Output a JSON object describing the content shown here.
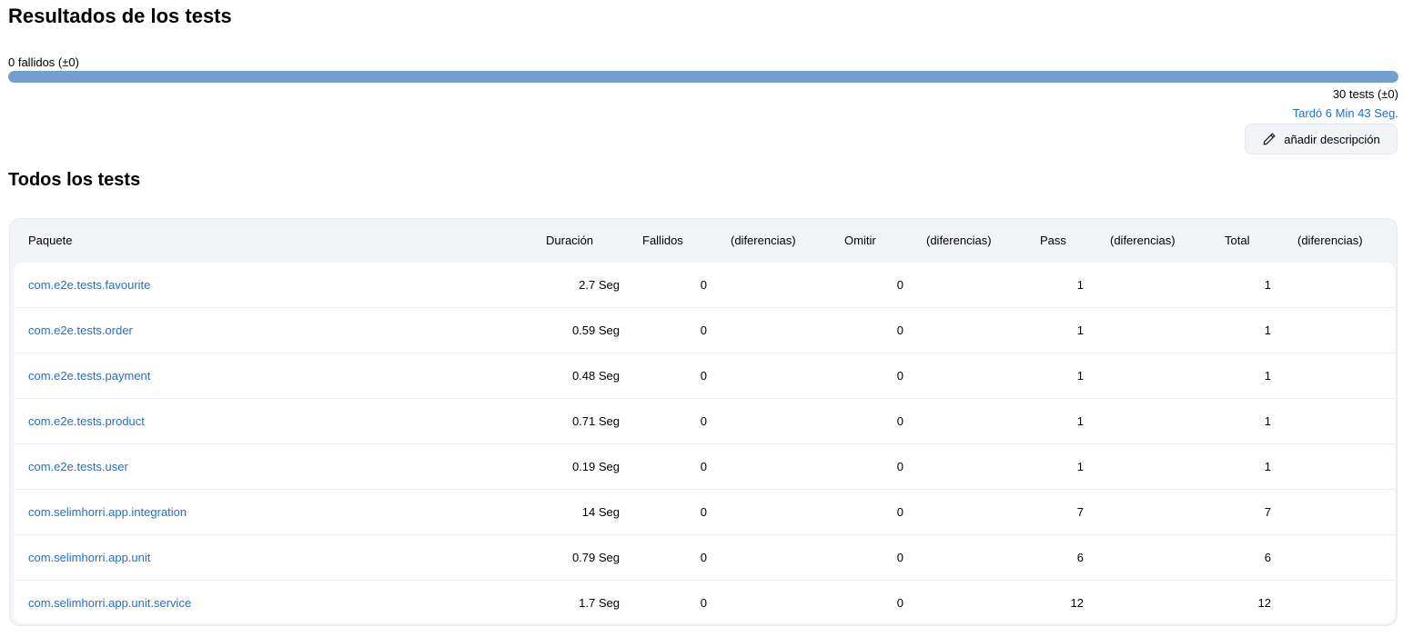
{
  "header": {
    "title": "Resultados de los tests",
    "failed_label": "0 fallidos (±0)",
    "pass_fraction": 1.0,
    "tests_count": "30 tests (±0)",
    "duration_text": "Tardó 6 Min 43 Seg.",
    "add_description_label": "añadir descripción"
  },
  "colors": {
    "progress_fill": "#729fcf",
    "link": "#1f6fd1"
  },
  "section": {
    "title": "Todos los tests"
  },
  "table": {
    "headers": {
      "package": "Paquete",
      "duration": "Duración",
      "failed": "Fallidos",
      "failed_diff": "(diferencias)",
      "skip": "Omitir",
      "skip_diff": "(diferencias)",
      "pass": "Pass",
      "pass_diff": "(diferencias)",
      "total": "Total",
      "total_diff": "(diferencias)"
    },
    "rows": [
      {
        "package": "com.e2e.tests.favourite",
        "duration": "2.7 Seg",
        "failed": "0",
        "skip": "0",
        "pass": "1",
        "total": "1"
      },
      {
        "package": "com.e2e.tests.order",
        "duration": "0.59 Seg",
        "failed": "0",
        "skip": "0",
        "pass": "1",
        "total": "1"
      },
      {
        "package": "com.e2e.tests.payment",
        "duration": "0.48 Seg",
        "failed": "0",
        "skip": "0",
        "pass": "1",
        "total": "1"
      },
      {
        "package": "com.e2e.tests.product",
        "duration": "0.71 Seg",
        "failed": "0",
        "skip": "0",
        "pass": "1",
        "total": "1"
      },
      {
        "package": "com.e2e.tests.user",
        "duration": "0.19 Seg",
        "failed": "0",
        "skip": "0",
        "pass": "1",
        "total": "1"
      },
      {
        "package": "com.selimhorri.app.integration",
        "duration": "14 Seg",
        "failed": "0",
        "skip": "0",
        "pass": "7",
        "total": "7"
      },
      {
        "package": "com.selimhorri.app.unit",
        "duration": "0.79 Seg",
        "failed": "0",
        "skip": "0",
        "pass": "6",
        "total": "6"
      },
      {
        "package": "com.selimhorri.app.unit.service",
        "duration": "1.7 Seg",
        "failed": "0",
        "skip": "0",
        "pass": "12",
        "total": "12"
      }
    ]
  },
  "icons": {
    "add_description": "pencil-icon"
  }
}
